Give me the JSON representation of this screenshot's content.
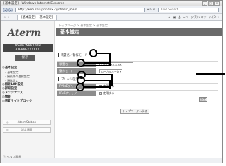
{
  "window": {
    "title": "[基本設定] - Windows Internet Explorer",
    "controls": [
      "_",
      "□",
      "×"
    ]
  },
  "address_bar": {
    "back_icon": "back-arrow-icon",
    "forward_icon": "forward-arrow-icon",
    "url": "http://web.setup/index.cgi/basic_main",
    "buttons": "▾ ⁴₉ ✕",
    "search_placeholder": "Live Search"
  },
  "toolbar": {
    "favorites": "☆ ☆",
    "tab_label": "[基本設定] - [基本設定]",
    "tools": "⌂ · ▣ · ⎙ · ▸ページ(P) ▾ ⚙ツール(O) ▾"
  },
  "sidebar": {
    "logo": "Aterm",
    "model_line1": "Aterm WR8100N",
    "model_line2": "ATERM-XXXXXX",
    "save_button": "保存",
    "menu": [
      {
        "label": "◎基本設定",
        "type": "head"
      },
      {
        "label": "・基本設定",
        "type": "sub"
      },
      {
        "label": "・接続先の選択設定",
        "type": "sub"
      },
      {
        "label": "・現状設定",
        "type": "sub"
      },
      {
        "label": "◎無線LAN設定",
        "type": "head"
      },
      {
        "label": "◎詳細設定",
        "type": "head"
      },
      {
        "label": "◎メンテナンス",
        "type": "head"
      },
      {
        "label": "◎情報",
        "type": "head"
      },
      {
        "label": "◎悪質サイトブロック",
        "type": "head"
      }
    ],
    "buttons": [
      {
        "label": "AtermStation",
        "bullet": "◎"
      },
      {
        "label": "設定画面",
        "bullet": "◎"
      }
    ],
    "help_link": "ⓘ ヘルプ表示"
  },
  "main": {
    "breadcrumb": "トップページ > 基本設定 > 基本設定",
    "page_title": "基本設定",
    "section1_title": "装置名／動作モード",
    "row_device_name": {
      "label": "装置名",
      "value": "ATERM-XXXXXX"
    },
    "row_mode": {
      "label": "動作モード",
      "value": "ローカルルータ"
    },
    "section2_title": "ブリッジ設定",
    "row_pppoe": {
      "label": "PPPoEブリッジ",
      "value": "使用する"
    },
    "row_ipv6": {
      "label": "IPv6ブリッジ",
      "value": "使用する"
    },
    "set_button": "設定",
    "top_button": "トップページへ戻る"
  },
  "status_bar": {
    "text": ""
  }
}
